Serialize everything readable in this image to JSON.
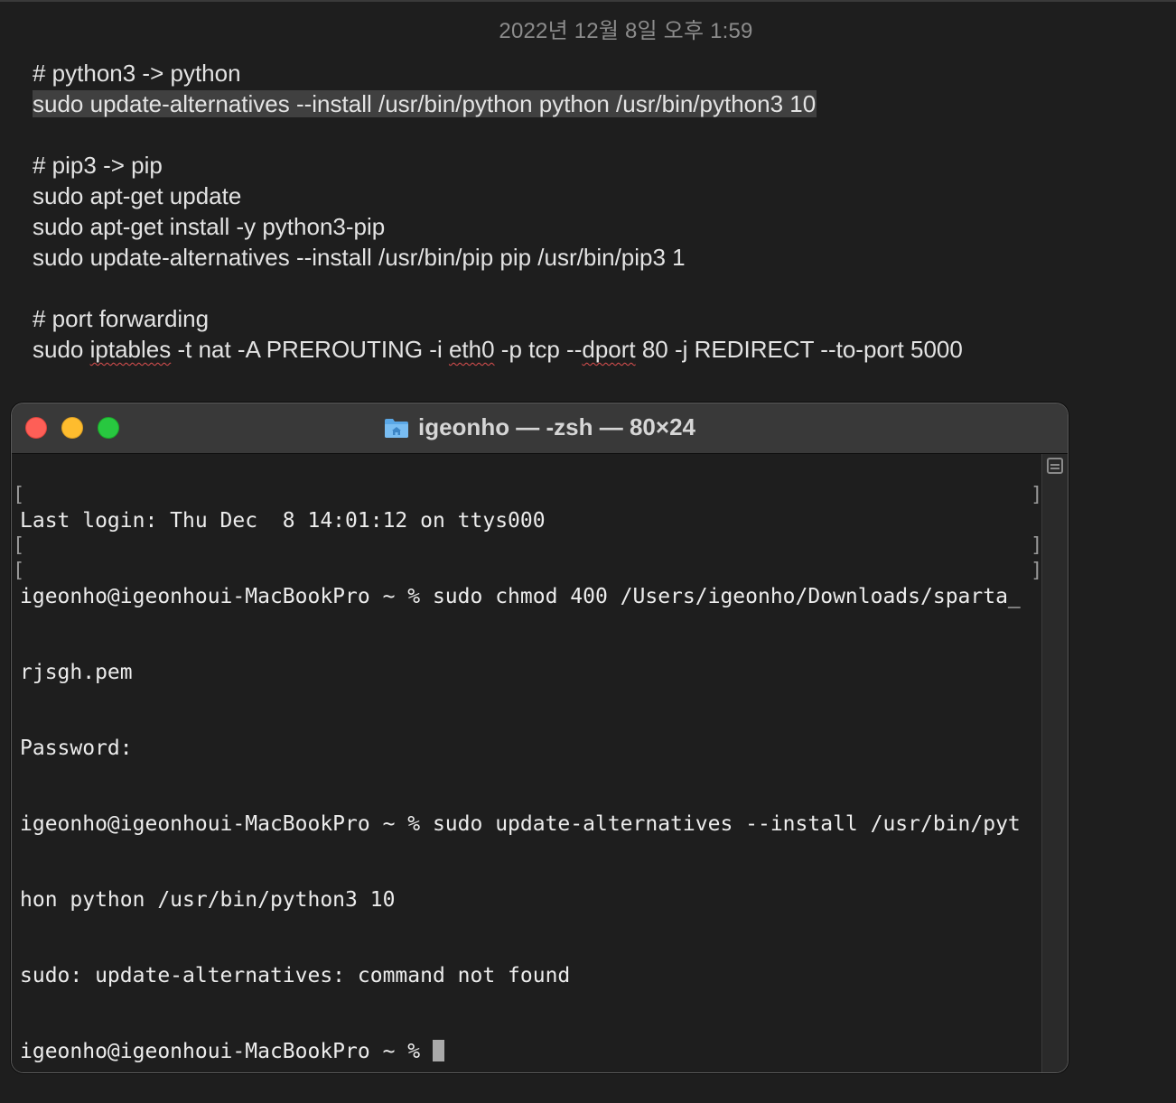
{
  "note": {
    "date": "2022년 12월 8일 오후 1:59",
    "lines": [
      "# python3 -> python",
      "sudo update-alternatives --install /usr/bin/python python /usr/bin/python3 10",
      "",
      "# pip3 -> pip",
      "sudo apt-get update",
      "sudo apt-get install -y python3-pip",
      "sudo update-alternatives --install /usr/bin/pip pip /usr/bin/pip3 1",
      "",
      "# port forwarding"
    ],
    "iptables_line": {
      "p1": "sudo ",
      "w1": "iptables",
      "p2": " -t nat -A PREROUTING -i ",
      "w2": "eth0",
      "p3": " -p tcp --",
      "w3": "dport",
      "p4": " 80 -j REDIRECT --to-port 5000"
    }
  },
  "terminal": {
    "title": "igeonho — -zsh — 80×24",
    "lines": [
      "Last login: Thu Dec  8 14:01:12 on ttys000",
      "igeonho@igeonhoui-MacBookPro ~ % sudo chmod 400 /Users/igeonho/Downloads/sparta_",
      "rjsgh.pem",
      "Password:",
      "igeonho@igeonhoui-MacBookPro ~ % sudo update-alternatives --install /usr/bin/pyt",
      "hon python /usr/bin/python3 10",
      "sudo: update-alternatives: command not found"
    ],
    "prompt": "igeonho@igeonhoui-MacBookPro ~ % ",
    "bracket_left": "[",
    "bracket_right": "]"
  },
  "icons": {
    "window_close": "close-button",
    "window_minimize": "minimize-button",
    "window_zoom": "zoom-button",
    "title_icon": "home-folder-icon",
    "scroll": "scroll-marks-icon"
  },
  "colors": {
    "close": "#fe5f57",
    "minimize": "#febc2e",
    "zoom": "#28c840",
    "highlight": "#404040"
  }
}
